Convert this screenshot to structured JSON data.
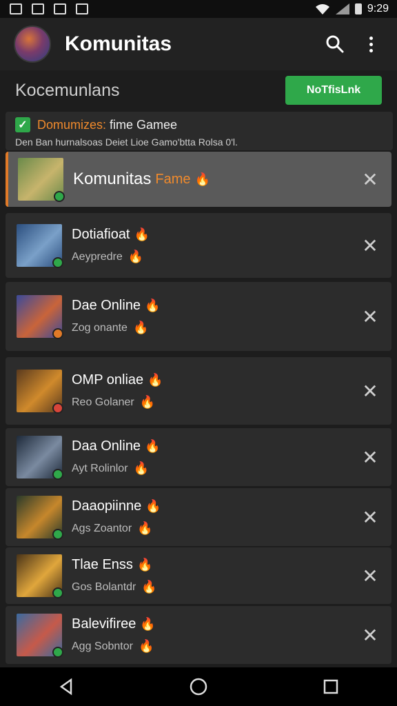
{
  "status": {
    "time": "9:29",
    "signal_icons": [
      "wifi-icon",
      "cell-signal-icon",
      "battery-icon"
    ]
  },
  "appbar": {
    "title": "Komunitas",
    "search_icon": "search-icon",
    "menu_icon": "more-vert-icon"
  },
  "subheader": {
    "title": "Kocemunlans",
    "button_label": "NoTfisLnk"
  },
  "info": {
    "title_highlight": "Domumizes:",
    "title_rest": " fime Gamee",
    "desc": "Den Ban hurnalsoas Deiet Lioe Gamo'btta Rolsa 0'l."
  },
  "items": [
    {
      "title": "Komunitas",
      "extra": "Fame",
      "subtitle": "",
      "active": true,
      "badge_color": "#2fa84a",
      "thumb_colors": [
        "#6a8a4a",
        "#c7b46c"
      ]
    },
    {
      "title": "Dotiafioat",
      "extra": "",
      "subtitle": "Aeypredre",
      "active": false,
      "badge_color": "#2fa84a",
      "thumb_colors": [
        "#2b4e7e",
        "#7aa0c8"
      ]
    },
    {
      "title": "Dae Online",
      "extra": "",
      "subtitle": "Zog onante",
      "active": false,
      "badge_color": "#e07a28",
      "thumb_colors": [
        "#3b4a9a",
        "#c9643a"
      ]
    },
    {
      "title": "OMP onliae",
      "extra": "",
      "subtitle": "Reo Golaner",
      "active": false,
      "badge_color": "#d9453a",
      "thumb_colors": [
        "#5a3a1e",
        "#d08a2c"
      ]
    },
    {
      "title": "Daa Online",
      "extra": "",
      "subtitle": "Ayt Rolinlor",
      "active": false,
      "badge_color": "#2fa84a",
      "thumb_colors": [
        "#1e2a3a",
        "#7a8aa0"
      ]
    },
    {
      "title": "Daaopiinne",
      "extra": "",
      "subtitle": "Ags Zoantor",
      "active": false,
      "badge_color": "#2fa84a",
      "thumb_colors": [
        "#2a3a2a",
        "#c6872c"
      ]
    },
    {
      "title": "Tlae Enss",
      "extra": "",
      "subtitle": "Gos Bolantdr",
      "active": false,
      "badge_color": "#2fa84a",
      "thumb_colors": [
        "#4a3418",
        "#e0a63c"
      ]
    },
    {
      "title": "Balevifiree",
      "extra": "",
      "subtitle": "Agg Sobntor",
      "active": false,
      "badge_color": "#2fa84a",
      "thumb_colors": [
        "#3a6aa0",
        "#c65a4a"
      ]
    }
  ],
  "nav": {
    "back_icon": "back-icon",
    "home_icon": "home-icon",
    "recents_icon": "recents-icon"
  }
}
